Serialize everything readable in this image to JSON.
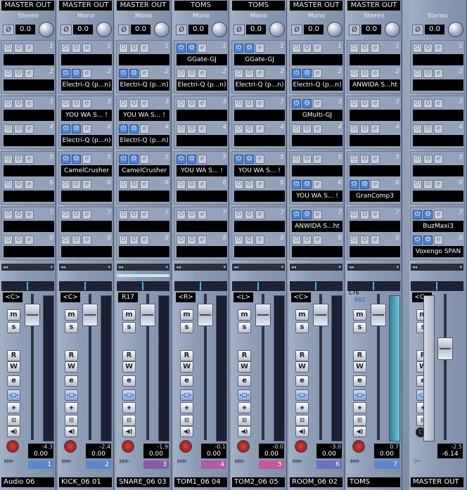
{
  "channels": [
    {
      "output": "MASTER OUT",
      "config": "Stereo",
      "gain": "0.0",
      "inserts": [
        {
          "no": "1",
          "name": "",
          "on": false
        },
        {
          "no": "2",
          "name": "",
          "on": false
        },
        {
          "no": "3",
          "name": "",
          "on": false
        },
        {
          "no": "4",
          "name": "",
          "on": false
        },
        {
          "no": "5",
          "name": "",
          "on": false
        },
        {
          "no": "6",
          "name": "",
          "on": false
        },
        {
          "no": "7",
          "name": "",
          "on": false
        },
        {
          "no": "8",
          "name": "",
          "on": false
        }
      ],
      "pan": "<C>",
      "peak": "-4.3",
      "volume": "0.00",
      "number": "1",
      "name": "Audio 06",
      "color": "#5a86d0",
      "fader": 0.92
    },
    {
      "output": "MASTER OUT",
      "config": "Mono",
      "gain": "0.0",
      "inserts": [
        {
          "no": "1",
          "name": "",
          "on": false
        },
        {
          "no": "2",
          "name": "Electri-Q (p...n)",
          "on": true
        },
        {
          "no": "3",
          "name": "YOU WA S... !",
          "on": false
        },
        {
          "no": "4",
          "name": "Electri-Q (p...n)",
          "on": true
        },
        {
          "no": "5",
          "name": "CamelCrusher",
          "on": true
        },
        {
          "no": "6",
          "name": "",
          "on": false
        },
        {
          "no": "7",
          "name": "",
          "on": false
        },
        {
          "no": "8",
          "name": "",
          "on": false
        }
      ],
      "pan": "<C>",
      "peak": "-2.4",
      "volume": "0.00",
      "number": "2",
      "name": "KICK_06 01",
      "color": "#5a86d0",
      "fader": 0.92
    },
    {
      "output": "MASTER OUT",
      "config": "Mono",
      "gain": "0.0",
      "inserts": [
        {
          "no": "1",
          "name": "",
          "on": false
        },
        {
          "no": "2",
          "name": "Electri-Q (p...n)",
          "on": true
        },
        {
          "no": "3",
          "name": "YOU WA S... !",
          "on": false
        },
        {
          "no": "4",
          "name": "Electri-Q (p...n)",
          "on": true
        },
        {
          "no": "5",
          "name": "CamelCrusher",
          "on": true
        },
        {
          "no": "6",
          "name": "",
          "on": false
        },
        {
          "no": "7",
          "name": "",
          "on": false
        },
        {
          "no": "8",
          "name": "",
          "on": false
        }
      ],
      "pan": "R17",
      "peak": "-1.9",
      "volume": "0.00",
      "number": "3",
      "name": "SNARE_06 03",
      "color": "#8a5aa8",
      "fader": 0.92
    },
    {
      "output": "TOMS",
      "config": "Mono",
      "gain": "0.0",
      "inserts": [
        {
          "no": "1",
          "name": "GGate-GJ",
          "on": true
        },
        {
          "no": "2",
          "name": "Electri-Q (p...n)",
          "on": false
        },
        {
          "no": "3",
          "name": "",
          "on": false
        },
        {
          "no": "4",
          "name": "",
          "on": false
        },
        {
          "no": "5",
          "name": "YOU WA S... !",
          "on": true
        },
        {
          "no": "6",
          "name": "",
          "on": false
        },
        {
          "no": "7",
          "name": "",
          "on": false
        },
        {
          "no": "8",
          "name": "",
          "on": false
        }
      ],
      "pan": "<R>",
      "peak": "-0.1",
      "volume": "0.00",
      "number": "4",
      "name": "TOM1_06 04",
      "color": "#b05aa8",
      "fader": 0.92
    },
    {
      "output": "TOMS",
      "config": "Mono",
      "gain": "0.0",
      "inserts": [
        {
          "no": "1",
          "name": "GGate-GJ",
          "on": true
        },
        {
          "no": "2",
          "name": "Electri-Q (p...n)",
          "on": false
        },
        {
          "no": "3",
          "name": "",
          "on": false
        },
        {
          "no": "4",
          "name": "",
          "on": false
        },
        {
          "no": "5",
          "name": "YOU WA S... !",
          "on": true
        },
        {
          "no": "6",
          "name": "",
          "on": false
        },
        {
          "no": "7",
          "name": "",
          "on": false
        },
        {
          "no": "8",
          "name": "",
          "on": false
        }
      ],
      "pan": "<L>",
      "peak": "-0.0",
      "volume": "0.00",
      "number": "5",
      "name": "TOM2_06 05",
      "color": "#c05a9a",
      "fader": 0.92
    },
    {
      "output": "MASTER OUT",
      "config": "Mono",
      "gain": "0.0",
      "inserts": [
        {
          "no": "1",
          "name": "",
          "on": false
        },
        {
          "no": "2",
          "name": "Electri-Q (p...n)",
          "on": true
        },
        {
          "no": "3",
          "name": "GMulti-GJ",
          "on": true
        },
        {
          "no": "4",
          "name": "",
          "on": false
        },
        {
          "no": "5",
          "name": "",
          "on": false
        },
        {
          "no": "6",
          "name": "YOU WA S... !",
          "on": true
        },
        {
          "no": "7",
          "name": "ANWIDA S...ht",
          "on": true
        },
        {
          "no": "8",
          "name": "",
          "on": false
        }
      ],
      "pan": "<C>",
      "peak": "-3.0",
      "volume": "0.00",
      "number": "6",
      "name": "ROOM_06 02",
      "color": "#6a72c0",
      "fader": 0.92
    },
    {
      "output": "MASTER OUT",
      "config": "Stereo",
      "gain": "0.0",
      "inserts": [
        {
          "no": "1",
          "name": "",
          "on": false
        },
        {
          "no": "2",
          "name": "ANWIDA S...ht",
          "on": false
        },
        {
          "no": "3",
          "name": "",
          "on": false
        },
        {
          "no": "4",
          "name": "",
          "on": false
        },
        {
          "no": "5",
          "name": "",
          "on": false
        },
        {
          "no": "6",
          "name": "GranComp3",
          "on": true
        },
        {
          "no": "7",
          "name": "",
          "on": false
        },
        {
          "no": "8",
          "name": "",
          "on": false
        }
      ],
      "pan_l": "L76",
      "pan_r": "R62",
      "peak": "0.7",
      "volume": "0.00",
      "number": "7",
      "name": "TOMS",
      "color": "#5a86d0",
      "fader": 0.92
    }
  ],
  "master": {
    "title": "Stereo",
    "output": "MASTER OUT",
    "gain": "0.0",
    "inserts": [
      {
        "no": "1",
        "name": "",
        "on": false
      },
      {
        "no": "2",
        "name": "",
        "on": false
      },
      {
        "no": "3",
        "name": "",
        "on": false
      },
      {
        "no": "4",
        "name": "",
        "on": false
      },
      {
        "no": "5",
        "name": "",
        "on": false
      },
      {
        "no": "6",
        "name": "",
        "on": false
      },
      {
        "no": "7",
        "name": "BuzMaxi3",
        "on": true
      },
      {
        "no": "8",
        "name": "Voxengo SPAN",
        "on": true
      }
    ],
    "pan": "<C>",
    "peak": "-2.5",
    "volume": "-6.14",
    "name": "MASTER OUT",
    "fader": 0.65
  },
  "labels": {
    "m": "m",
    "s": "s",
    "r": "R",
    "w": "W",
    "e": "e",
    "phase": "Ø",
    "power_icon": "power-icon",
    "bypass_icon": "bypass-icon",
    "edit": "e",
    "master_c": "C"
  }
}
